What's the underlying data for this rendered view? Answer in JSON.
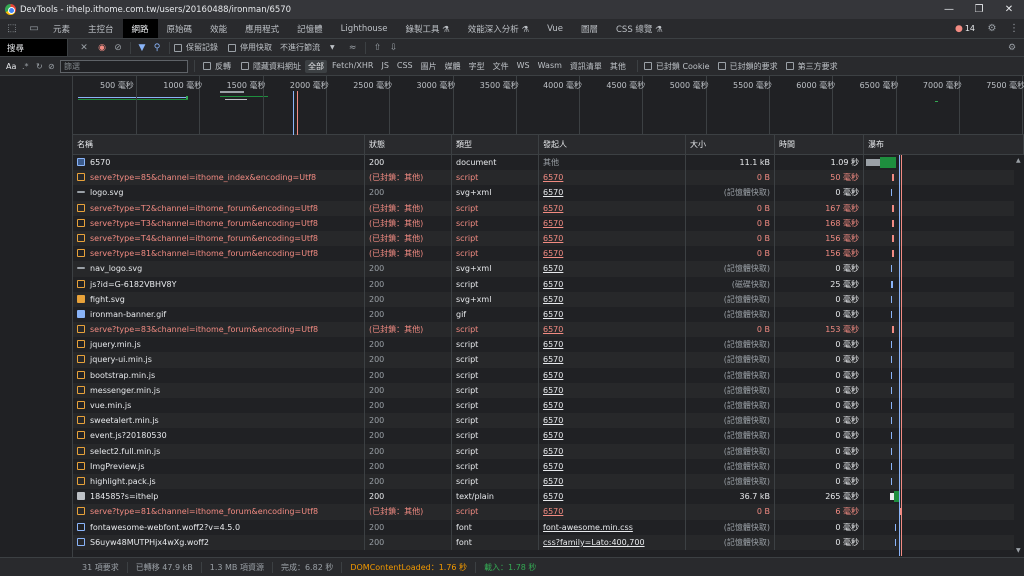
{
  "window": {
    "title": "DevTools - ithelp.ithome.com.tw/users/20160488/ironman/6570"
  },
  "panels": [
    "元素",
    "主控台",
    "網路",
    "原始碼",
    "效能",
    "應用程式",
    "記憶體",
    "Lighthouse",
    "錄製工具 ⚗",
    "效能深入分析 ⚗",
    "Vue",
    "圖層",
    "CSS 總覽 ⚗"
  ],
  "issues_count": "14",
  "toolbar": {
    "search_tab": "搜尋",
    "preserve_log": "保留記錄",
    "disable_cache": "停用快取",
    "throttle": "不進行節流"
  },
  "filter": {
    "case_label": "Aa",
    "placeholder": "篩選",
    "invert": "反轉",
    "hide_data_urls": "隱藏資料網址",
    "types": [
      "全部",
      "Fetch/XHR",
      "JS",
      "CSS",
      "圖片",
      "媒體",
      "字型",
      "文件",
      "WS",
      "Wasm",
      "資訊清單",
      "其他"
    ],
    "blocked_cookies": "已封鎖 Cookie",
    "blocked_requests": "已封鎖的要求",
    "third_party": "第三方要求"
  },
  "timeline": {
    "ticks": [
      "500 毫秒",
      "1000 毫秒",
      "1500 毫秒",
      "2000 毫秒",
      "2500 毫秒",
      "3000 毫秒",
      "3500 毫秒",
      "4000 毫秒",
      "4500 毫秒",
      "5000 毫秒",
      "5500 毫秒",
      "6000 毫秒",
      "6500 毫秒",
      "7000 毫秒",
      "7500 毫秒"
    ]
  },
  "columns": [
    "名稱",
    "狀態",
    "類型",
    "發起人",
    "大小",
    "時間",
    "瀑布"
  ],
  "rows": [
    {
      "name": "6570",
      "status": "200",
      "type": "document",
      "initiator": "其他",
      "size": "11.1 kB",
      "time": "1.09 秒",
      "kind": "doc",
      "blocked": false
    },
    {
      "name": "serve?type=85&channel=ithome_index&encoding=Utf8",
      "status": "(已封鎖：其他)",
      "type": "script",
      "initiator": "6570",
      "size": "0 B",
      "time": "50 毫秒",
      "kind": "js",
      "blocked": true
    },
    {
      "name": "logo.svg",
      "status": "200",
      "type": "svg+xml",
      "initiator": "6570",
      "size": "(記憶體快取)",
      "time": "0 毫秒",
      "kind": "img",
      "blocked": false
    },
    {
      "name": "serve?type=T2&channel=ithome_forum&encoding=Utf8",
      "status": "(已封鎖：其他)",
      "type": "script",
      "initiator": "6570",
      "size": "0 B",
      "time": "167 毫秒",
      "kind": "js",
      "blocked": true
    },
    {
      "name": "serve?type=T3&channel=ithome_forum&encoding=Utf8",
      "status": "(已封鎖：其他)",
      "type": "script",
      "initiator": "6570",
      "size": "0 B",
      "time": "168 毫秒",
      "kind": "js",
      "blocked": true
    },
    {
      "name": "serve?type=T4&channel=ithome_forum&encoding=Utf8",
      "status": "(已封鎖：其他)",
      "type": "script",
      "initiator": "6570",
      "size": "0 B",
      "time": "156 毫秒",
      "kind": "js",
      "blocked": true
    },
    {
      "name": "serve?type=81&channel=ithome_forum&encoding=Utf8",
      "status": "(已封鎖：其他)",
      "type": "script",
      "initiator": "6570",
      "size": "0 B",
      "time": "156 毫秒",
      "kind": "js",
      "blocked": true
    },
    {
      "name": "nav_logo.svg",
      "status": "200",
      "type": "svg+xml",
      "initiator": "6570",
      "size": "(記憶體快取)",
      "time": "0 毫秒",
      "kind": "img",
      "blocked": false
    },
    {
      "name": "js?id=G-6182VBHV8Y",
      "status": "200",
      "type": "script",
      "initiator": "6570",
      "size": "(磁碟快取)",
      "time": "25 毫秒",
      "kind": "js",
      "blocked": false
    },
    {
      "name": "fight.svg",
      "status": "200",
      "type": "svg+xml",
      "initiator": "6570",
      "size": "(記憶體快取)",
      "time": "0 毫秒",
      "kind": "img2",
      "blocked": false
    },
    {
      "name": "ironman-banner.gif",
      "status": "200",
      "type": "gif",
      "initiator": "6570",
      "size": "(記憶體快取)",
      "time": "0 毫秒",
      "kind": "img3",
      "blocked": false
    },
    {
      "name": "serve?type=83&channel=ithome_forum&encoding=Utf8",
      "status": "(已封鎖：其他)",
      "type": "script",
      "initiator": "6570",
      "size": "0 B",
      "time": "153 毫秒",
      "kind": "js",
      "blocked": true
    },
    {
      "name": "jquery.min.js",
      "status": "200",
      "type": "script",
      "initiator": "6570",
      "size": "(記憶體快取)",
      "time": "0 毫秒",
      "kind": "js",
      "blocked": false
    },
    {
      "name": "jquery-ui.min.js",
      "status": "200",
      "type": "script",
      "initiator": "6570",
      "size": "(記憶體快取)",
      "time": "0 毫秒",
      "kind": "js",
      "blocked": false
    },
    {
      "name": "bootstrap.min.js",
      "status": "200",
      "type": "script",
      "initiator": "6570",
      "size": "(記憶體快取)",
      "time": "0 毫秒",
      "kind": "js",
      "blocked": false
    },
    {
      "name": "messenger.min.js",
      "status": "200",
      "type": "script",
      "initiator": "6570",
      "size": "(記憶體快取)",
      "time": "0 毫秒",
      "kind": "js",
      "blocked": false
    },
    {
      "name": "vue.min.js",
      "status": "200",
      "type": "script",
      "initiator": "6570",
      "size": "(記憶體快取)",
      "time": "0 毫秒",
      "kind": "js",
      "blocked": false
    },
    {
      "name": "sweetalert.min.js",
      "status": "200",
      "type": "script",
      "initiator": "6570",
      "size": "(記憶體快取)",
      "time": "0 毫秒",
      "kind": "js",
      "blocked": false
    },
    {
      "name": "event.js?20180530",
      "status": "200",
      "type": "script",
      "initiator": "6570",
      "size": "(記憶體快取)",
      "time": "0 毫秒",
      "kind": "js",
      "blocked": false
    },
    {
      "name": "select2.full.min.js",
      "status": "200",
      "type": "script",
      "initiator": "6570",
      "size": "(記憶體快取)",
      "time": "0 毫秒",
      "kind": "js",
      "blocked": false
    },
    {
      "name": "ImgPreview.js",
      "status": "200",
      "type": "script",
      "initiator": "6570",
      "size": "(記憶體快取)",
      "time": "0 毫秒",
      "kind": "js",
      "blocked": false
    },
    {
      "name": "highlight.pack.js",
      "status": "200",
      "type": "script",
      "initiator": "6570",
      "size": "(記憶體快取)",
      "time": "0 毫秒",
      "kind": "js",
      "blocked": false
    },
    {
      "name": "184585?s=ithelp",
      "status": "200",
      "type": "text/plain",
      "initiator": "6570",
      "size": "36.7 kB",
      "time": "265 毫秒",
      "kind": "txt",
      "blocked": false
    },
    {
      "name": "serve?type=81&channel=ithome_forum&encoding=Utf8",
      "status": "(已封鎖：其他)",
      "type": "script",
      "initiator": "6570",
      "size": "0 B",
      "time": "6 毫秒",
      "kind": "js",
      "blocked": true
    },
    {
      "name": "fontawesome-webfont.woff2?v=4.5.0",
      "status": "200",
      "type": "font",
      "initiator": "font-awesome.min.css",
      "size": "(記憶體快取)",
      "time": "0 毫秒",
      "kind": "font",
      "blocked": false
    },
    {
      "name": "S6uyw48MUTPHjx4wXg.woff2",
      "status": "200",
      "type": "font",
      "initiator": "css?family=Lato:400,700",
      "size": "(記憶體快取)",
      "time": "0 毫秒",
      "kind": "font",
      "blocked": false
    }
  ],
  "status": {
    "requests": "31 項要求",
    "transferred": "已轉移 47.9 kB",
    "resources": "1.3 MB 項資源",
    "finish": "完成：6.82 秒",
    "dcl": "DOMContentLoaded：1.76 秒",
    "load": "載入：1.78 秒"
  },
  "colors": {
    "dcl": "#8ab4f8",
    "load": "#f28b82",
    "dcl_text": "#f29900",
    "load_text": "#34a853",
    "blocked": "#f28b82"
  }
}
